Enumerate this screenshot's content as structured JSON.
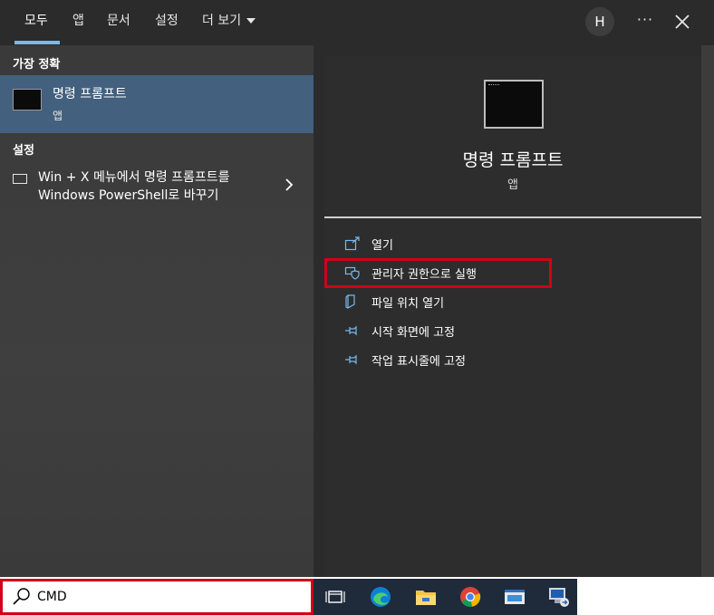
{
  "tabs": [
    {
      "label": "모두",
      "active": true
    },
    {
      "label": "앱"
    },
    {
      "label": "문서"
    },
    {
      "label": "설정"
    },
    {
      "label": "더 보기"
    }
  ],
  "header": {
    "avatar_initial": "H",
    "more_label": "···"
  },
  "left": {
    "best_match_heading": "가장 정확",
    "best_match": {
      "title": "명령 프롬프트",
      "subtitle": "앱",
      "icon": "cmd-icon"
    },
    "settings_heading": "설정",
    "setting_item": {
      "line1": "Win + X 메뉴에서 명령 프롬프트를",
      "line2": "Windows PowerShell로 바꾸기"
    }
  },
  "right": {
    "app_title": "명령 프롬프트",
    "app_subtitle": "앱",
    "actions": [
      {
        "label": "열기",
        "icon": "open-icon"
      },
      {
        "label": "관리자 권한으로 실행",
        "icon": "shield-icon",
        "highlighted": true
      },
      {
        "label": "파일 위치 열기",
        "icon": "file-location-icon"
      },
      {
        "label": "시작 화면에 고정",
        "icon": "pin-icon"
      },
      {
        "label": "작업 표시줄에 고정",
        "icon": "pin-icon"
      }
    ]
  },
  "search": {
    "value": "CMD"
  },
  "taskbar": {
    "items": [
      "task-view",
      "edge",
      "file-explorer",
      "chrome",
      "app-window",
      "remote-desktop"
    ]
  },
  "colors": {
    "highlight": "#d0021b",
    "accent": "#76b9ed",
    "selection": "#43607e"
  }
}
